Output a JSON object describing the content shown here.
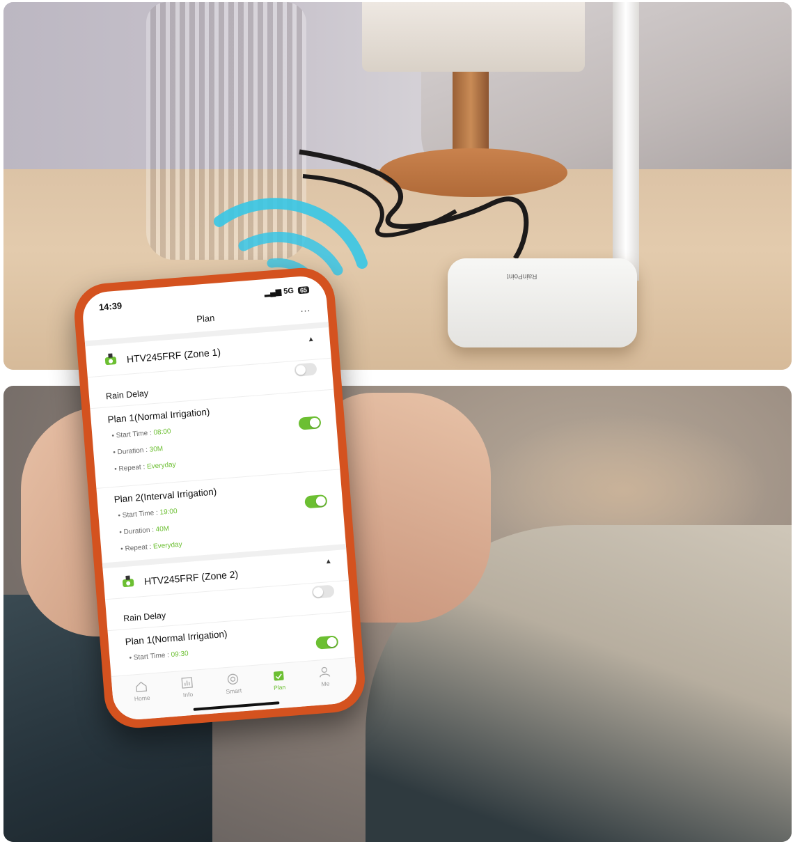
{
  "device_label": "RainPoint",
  "status": {
    "time": "14:39",
    "network": "5G",
    "battery": "65"
  },
  "header": {
    "title": "Plan",
    "more": "..."
  },
  "zones": [
    {
      "title": "HTV245FRF (Zone 1)",
      "rain_delay": {
        "label": "Rain Delay",
        "enabled": false
      },
      "plans": [
        {
          "title": "Plan 1(Normal Irrigation)",
          "enabled": true,
          "start_label": "Start Time : ",
          "start_value": "08:00",
          "duration_label": "Duration : ",
          "duration_value": "30M",
          "repeat_label": "Repeat : ",
          "repeat_value": "Everyday"
        },
        {
          "title": "Plan 2(Interval Irrigation)",
          "enabled": true,
          "start_label": "Start Time : ",
          "start_value": "19:00",
          "duration_label": "Duration : ",
          "duration_value": "40M",
          "repeat_label": "Repeat : ",
          "repeat_value": "Everyday"
        }
      ]
    },
    {
      "title": "HTV245FRF (Zone 2)",
      "rain_delay": {
        "label": "Rain Delay",
        "enabled": false
      },
      "plans": [
        {
          "title": "Plan 1(Normal Irrigation)",
          "enabled": true,
          "start_label": "Start Time : ",
          "start_value": "09:30"
        }
      ]
    }
  ],
  "tabs": [
    {
      "label": "Home",
      "icon": "home-icon",
      "active": false
    },
    {
      "label": "Info",
      "icon": "chart-icon",
      "active": false
    },
    {
      "label": "Smart",
      "icon": "smart-icon",
      "active": false
    },
    {
      "label": "Plan",
      "icon": "calendar-check-icon",
      "active": true
    },
    {
      "label": "Me",
      "icon": "user-icon",
      "active": false
    }
  ],
  "colors": {
    "accent": "#6cbf32",
    "phone_case": "#d4521f",
    "wifi": "#37c6e6"
  }
}
